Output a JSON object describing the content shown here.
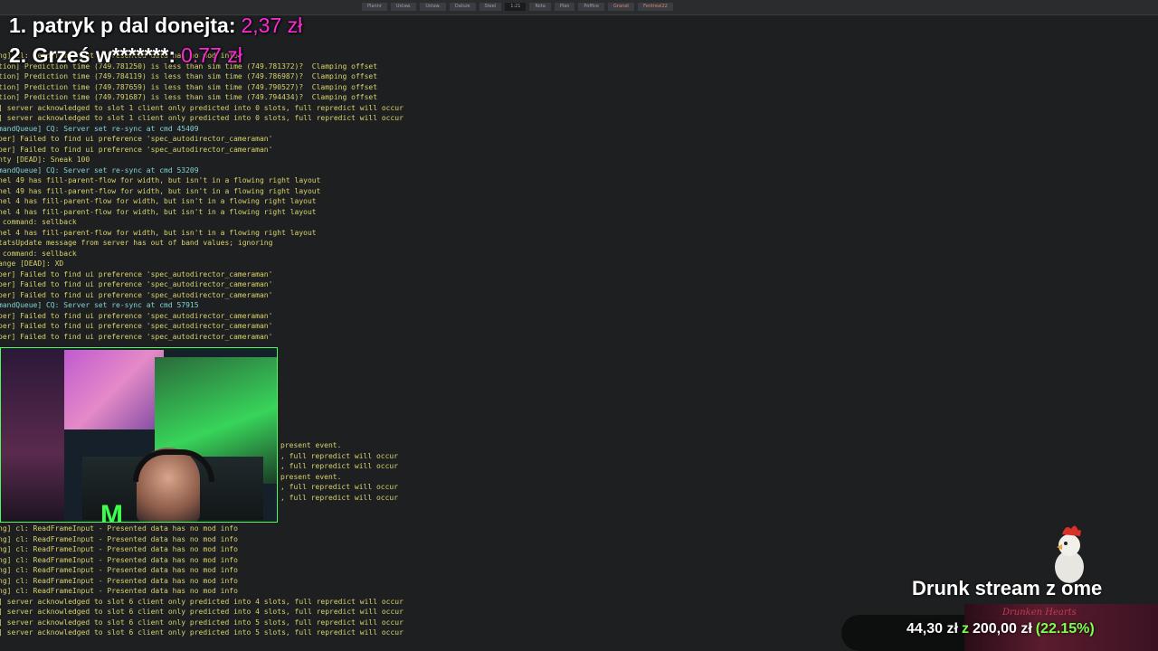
{
  "top_tabs": [
    "Plannr",
    "Ustaw.",
    "Ustaw.",
    "Dalsze",
    "Steel",
    "1:21",
    "Rota",
    "Plan",
    "Poffice",
    "Granat",
    "Fentreal22"
  ],
  "donors": [
    {
      "label": "1. patryk p dal donejta:",
      "amount": "2,37 zł"
    },
    {
      "label": "2. Grześ w*******:",
      "amount": "0.77 zł"
    }
  ],
  "console_lines": [
    {
      "text": "ng] cl: ReadFrameInput - Presented data has no mod info",
      "color": "yellow"
    },
    {
      "text": "tion] Prediction time (749.781250) is less than sim time (749.781372)?  Clamping offset",
      "color": "yellow"
    },
    {
      "text": "tion] Prediction time (749.784119) is less than sim time (749.786987)?  Clamping offset",
      "color": "yellow"
    },
    {
      "text": "tion] Prediction time (749.787659) is less than sim time (749.790527)?  Clamping offset",
      "color": "yellow"
    },
    {
      "text": "tion] Prediction time (749.791687) is less than sim time (749.794434)?  Clamping offset",
      "color": "yellow"
    },
    {
      "text": "] server acknowledged to slot 1 client only predicted into 0 slots, full repredict will occur",
      "color": "yellow"
    },
    {
      "text": "] server acknowledged to slot 1 client only predicted into 0 slots, full repredict will occur",
      "color": "yellow"
    },
    {
      "text": "mandQueue] CQ: Server set re-sync at cmd 45409",
      "color": "cyan"
    },
    {
      "text": "per] Failed to find ui preference 'spec_autodirector_cameraman'",
      "color": "yellow"
    },
    {
      "text": "per] Failed to find ui preference 'spec_autodirector_cameraman'",
      "color": "yellow"
    },
    {
      "text": "nty [DEAD]: Sneak 100",
      "color": "yellow"
    },
    {
      "text": "mandQueue] CQ: Server set re-sync at cmd 53209",
      "color": "cyan"
    },
    {
      "text": "nel 49 has fill-parent-flow for width, but isn't in a flowing right layout",
      "color": "yellow"
    },
    {
      "text": "nel 49 has fill-parent-flow for width, but isn't in a flowing right layout",
      "color": "yellow"
    },
    {
      "text": "nel 4 has fill-parent-flow for width, but isn't in a flowing right layout",
      "color": "yellow"
    },
    {
      "text": "nel 4 has fill-parent-flow for width, but isn't in a flowing right layout",
      "color": "yellow"
    },
    {
      "text": " command: sellback",
      "color": "yellow"
    },
    {
      "text": "nel 4 has fill-parent-flow for width, but isn't in a flowing right layout",
      "color": "yellow"
    },
    {
      "text": "tatsUpdate message from server has out of band values; ignoring",
      "color": "yellow"
    },
    {
      "text": " command: sellback",
      "color": "yellow"
    },
    {
      "text": "ange [DEAD]: XD",
      "color": "yellow"
    },
    {
      "text": "per] Failed to find ui preference 'spec_autodirector_cameraman'",
      "color": "yellow"
    },
    {
      "text": "per] Failed to find ui preference 'spec_autodirector_cameraman'",
      "color": "yellow"
    },
    {
      "text": "per] Failed to find ui preference 'spec_autodirector_cameraman'",
      "color": "yellow"
    },
    {
      "text": "mandQueue] CQ: Server set re-sync at cmd 57915",
      "color": "cyan"
    },
    {
      "text": "per] Failed to find ui preference 'spec_autodirector_cameraman'",
      "color": "yellow"
    },
    {
      "text": "per] Failed to find ui preference 'spec_autodirector_cameraman'",
      "color": "yellow"
    },
    {
      "text": "per] Failed to find ui preference 'spec_autodirector_cameraman'",
      "color": "yellow"
    }
  ],
  "console_lines_right": [
    {
      "text": "present event.",
      "color": "yellow"
    },
    {
      "text": ", full repredict will occur",
      "color": "yellow"
    },
    {
      "text": ", full repredict will occur",
      "color": "yellow"
    },
    {
      "text": "present event.",
      "color": "yellow"
    },
    {
      "text": ", full repredict will occur",
      "color": "yellow"
    },
    {
      "text": ", full repredict will occur",
      "color": "yellow"
    }
  ],
  "console_lines_bottom": [
    {
      "text": "ng] cl: ReadFrameInput - Presented data has no mod info",
      "color": "yellow"
    },
    {
      "text": "ng] cl: ReadFrameInput - Presented data has no mod info",
      "color": "yellow"
    },
    {
      "text": "ng] cl: ReadFrameInput - Presented data has no mod info",
      "color": "yellow"
    },
    {
      "text": "ng] cl: ReadFrameInput - Presented data has no mod info",
      "color": "yellow"
    },
    {
      "text": "ng] cl: ReadFrameInput - Presented data has no mod info",
      "color": "yellow"
    },
    {
      "text": "ng] cl: ReadFrameInput - Presented data has no mod info",
      "color": "yellow"
    },
    {
      "text": "ng] cl: ReadFrameInput - Presented data has no mod info",
      "color": "yellow"
    },
    {
      "text": "] server acknowledged to slot 6 client only predicted into 4 slots, full repredict will occur",
      "color": "yellow"
    },
    {
      "text": "] server acknowledged to slot 6 client only predicted into 4 slots, full repredict will occur",
      "color": "yellow"
    },
    {
      "text": "] server acknowledged to slot 6 client only predicted into 5 slots, full repredict will occur",
      "color": "yellow"
    },
    {
      "text": "] server acknowledged to slot 6 client only predicted into 5 slots, full repredict will occur",
      "color": "yellow"
    }
  ],
  "webcam_logo": "M",
  "goal": {
    "title": "Drunk stream z ome",
    "raised": "44,30 zł",
    "separator": "z",
    "target": "200,00 zł",
    "percent": "(22.15%)",
    "progress": 0.2215,
    "banner_script": "Drunken Hearts"
  },
  "colors": {
    "console_yellow": "#d7d36a",
    "console_cyan": "#7fd3d0",
    "donor_amount": "#ff2ad6",
    "webcam_border": "#46ff5a",
    "goal_accent": "#7cff4e"
  }
}
